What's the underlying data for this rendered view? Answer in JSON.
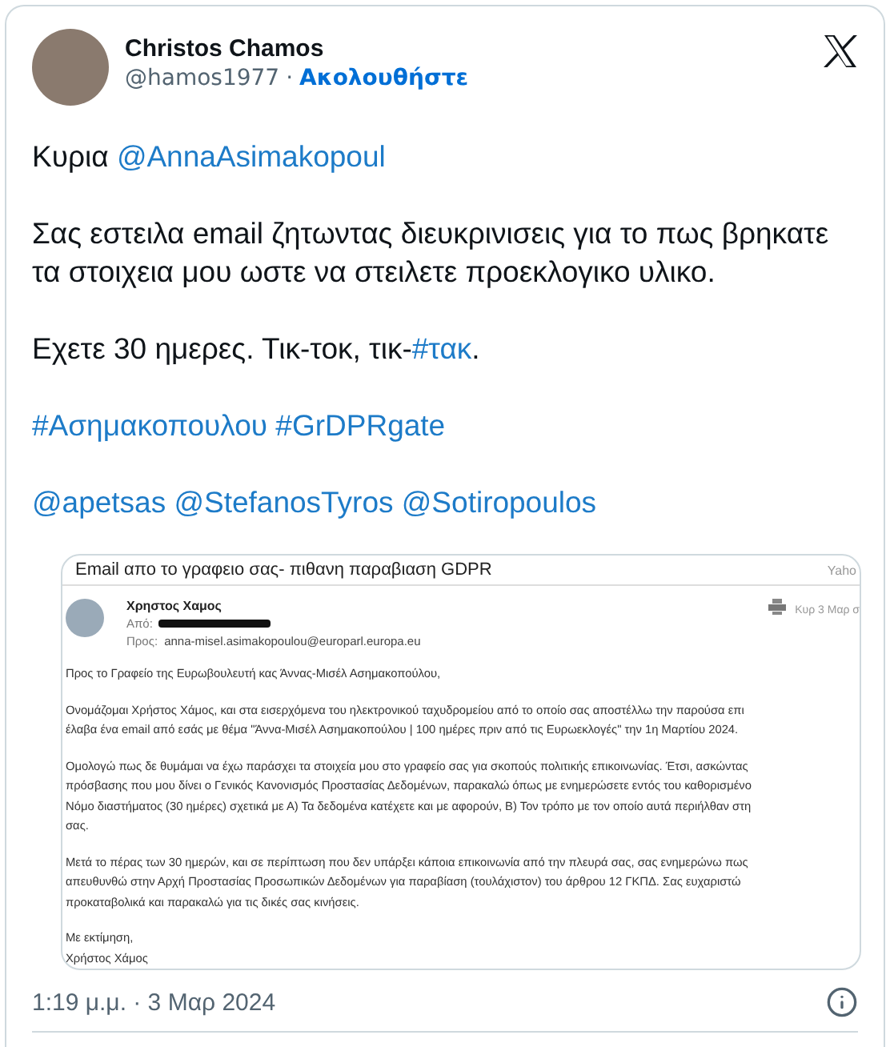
{
  "author": {
    "name": "Christos Chamos",
    "handle": "@hamos1977",
    "separator": "·",
    "follow": "Ακολουθήστε"
  },
  "paragraphs": [
    [
      {
        "kind": "text",
        "text": "Κυρια "
      },
      {
        "kind": "link",
        "text": "@AnnaAsimakopoul"
      }
    ],
    [
      {
        "kind": "text",
        "text": "Σας εστειλα email ζητωντας διευκρινισεις για το πως βρηκατε τα στοιχεια μου ωστε να στειλετε προεκλογικο υλικο."
      }
    ],
    [
      {
        "kind": "text",
        "text": "Εχετε 30 ημερες. Τικ-τοκ, τικ-"
      },
      {
        "kind": "link",
        "text": "#τακ"
      },
      {
        "kind": "text",
        "text": "."
      }
    ],
    [
      {
        "kind": "link",
        "text": "#Ασημακοπουλου"
      },
      {
        "kind": "link",
        "text": "#GrDPRgate"
      }
    ],
    [
      {
        "kind": "link",
        "text": "@apetsas"
      },
      {
        "kind": "link",
        "text": "@StefanosTyros"
      },
      {
        "kind": "link",
        "text": "@Sotiropoulos"
      }
    ]
  ],
  "email": {
    "subject": "Email απο το γραφειο σας- πιθανη παραβιαση GDPR",
    "mail_app": "Yaho",
    "sender": "Χρηστος Χαμος",
    "from_label": "Από:",
    "to_label": "Προς:",
    "to": "anna-misel.asimakopoulou@europarl.europa.eu",
    "date": "Κυρ 3 Μαρ σ",
    "body": [
      [
        "Προς το Γραφείο της Ευρωβουλευτή κας Άννας-Μισέλ Ασημακοπούλου,"
      ],
      [
        "Ονομάζομαι Χρήστος Χάμος, και στα εισερχόμενα του ηλεκτρονικού ταχυδρομείου από το οποίο σας αποστέλλω την παρούσα επι",
        "έλαβα ένα email από εσάς με θέμα \"Άννα-Μισέλ Ασημακοπούλου | 100 ημέρες πριν από τις Ευρωεκλογές\" την 1η Μαρτίου 2024."
      ],
      [
        "Ομολογώ πως δε θυμάμαι να έχω παράσχει τα στοιχεία μου στο γραφείο σας για σκοπούς πολιτικής επικοινωνίας. Έτσι, ασκώντας",
        "πρόσβασης που μου δίνει ο Γενικός Κανονισμός Προστασίας Δεδομένων, παρακαλώ όπως με ενημερώσετε εντός του καθορισμένο",
        "Νόμο διαστήματος (30 ημέρες) σχετικά με Α) Τα δεδομένα κατέχετε και με αφορούν, Β) Τον τρόπο με τον οποίο αυτά περιήλθαν στη",
        "σας."
      ],
      [
        "Μετά το πέρας των 30 ημερών, και σε περίπτωση που δεν υπάρξει κάποια επικοινωνία από την πλευρά σας, σας ενημερώνω πως",
        "απευθυνθώ στην Αρχή Προστασίας Προσωπικών Δεδομένων για παραβίαση (τουλάχιστον) του άρθρου 12 ΓΚΠΔ. Σας ευχαριστώ",
        "προκαταβολικά και παρακαλώ για τις δικές σας κινήσεις."
      ],
      [
        "Με εκτίμηση,",
        "Χρήστος Χάμος"
      ]
    ]
  },
  "timestamp": "1:19 μ.μ. · 3 Μαρ 2024"
}
